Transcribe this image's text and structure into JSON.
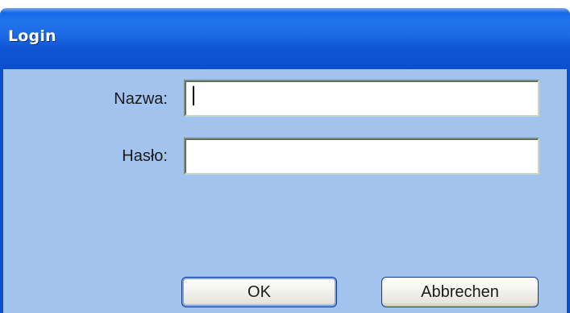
{
  "dialog": {
    "title": "Login"
  },
  "form": {
    "username_label": "Nazwa:",
    "username_value": "",
    "password_label": "Hasło:",
    "password_value": ""
  },
  "buttons": {
    "ok_label": "OK",
    "cancel_label": "Abbrechen"
  },
  "colors": {
    "titlebar": "#0b4fcd",
    "client_background": "#a3c3ef"
  }
}
